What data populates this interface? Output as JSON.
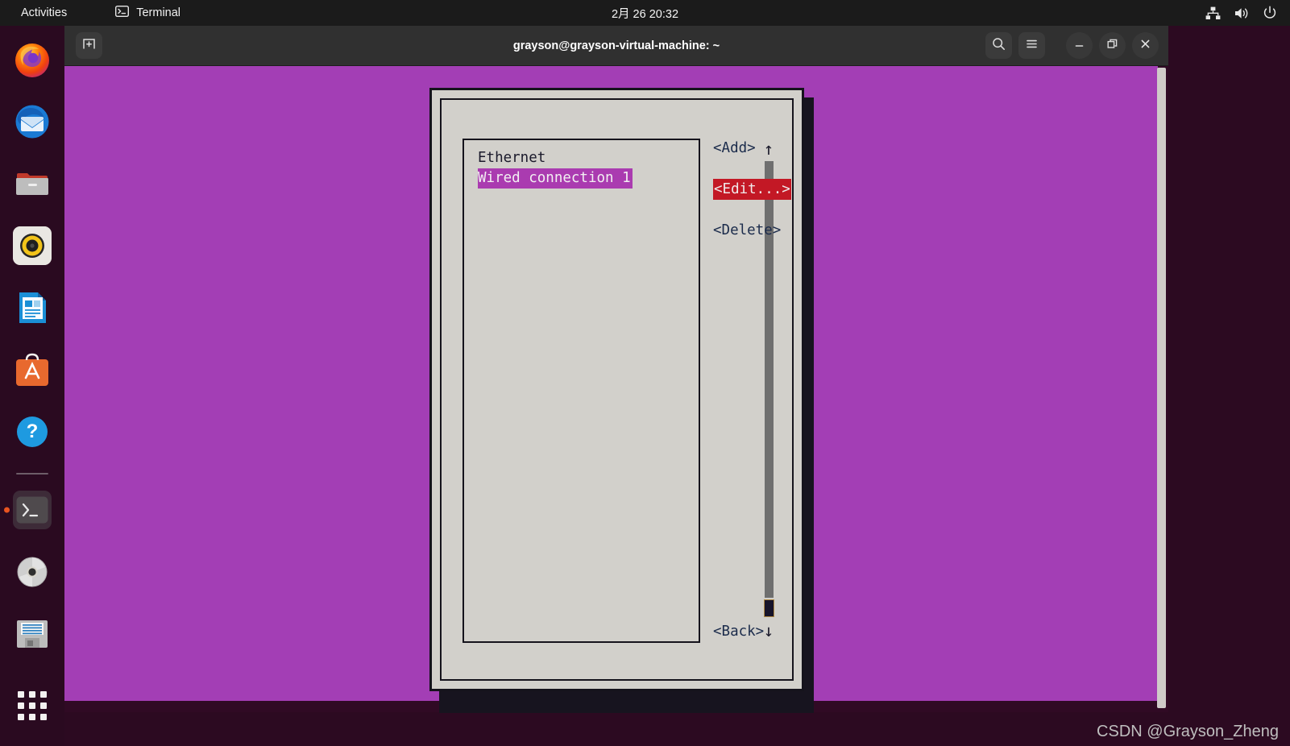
{
  "topbar": {
    "activities": "Activities",
    "app_name": "Terminal",
    "app_icon": "terminal-icon",
    "clock": "2月 26 20:32",
    "indicators": [
      {
        "name": "network-wired-icon",
        "label": "Network"
      },
      {
        "name": "volume-icon",
        "label": "Volume"
      },
      {
        "name": "power-icon",
        "label": "Power"
      }
    ]
  },
  "dock": {
    "items": [
      {
        "name": "firefox",
        "label": "Firefox",
        "running": false
      },
      {
        "name": "thunderbird",
        "label": "Thunderbird",
        "running": false
      },
      {
        "name": "files",
        "label": "Files",
        "running": false
      },
      {
        "name": "rhythmbox",
        "label": "Rhythmbox",
        "running": false
      },
      {
        "name": "libreoffice-writer",
        "label": "LibreOffice Writer",
        "running": false
      },
      {
        "name": "ubuntu-software",
        "label": "Ubuntu Software",
        "running": false
      },
      {
        "name": "help",
        "label": "Help",
        "running": false
      },
      {
        "name": "terminal",
        "label": "Terminal",
        "running": true
      },
      {
        "name": "disk-drive",
        "label": "CD/DVD Drive",
        "running": false
      },
      {
        "name": "floppy-disk",
        "label": "Floppy Disk",
        "running": false
      }
    ],
    "show_apps_label": "Show Applications"
  },
  "terminal": {
    "title": "grayson@grayson-virtual-machine: ~",
    "titlebar_buttons": {
      "new_tab": "new-tab-icon",
      "search": "search-icon",
      "menu": "hamburger-menu-icon",
      "minimize": "minimize-icon",
      "maximize": "maximize-icon",
      "close": "close-icon"
    }
  },
  "nmtui": {
    "list": {
      "group_label": "Ethernet",
      "items": [
        {
          "label": "Wired connection 1",
          "selected": true
        }
      ]
    },
    "scrollbar": {
      "up_arrow": "↑",
      "down_arrow": "↓"
    },
    "buttons": [
      {
        "label": "<Add>",
        "focused": false
      },
      {
        "label": "<Edit...>",
        "focused": true
      },
      {
        "label": "<Delete>",
        "focused": false
      }
    ],
    "back_button": {
      "label": "<Back>",
      "focused": false
    },
    "colors": {
      "dialog_bg": "#d2d0cb",
      "selection": "#aa3bb0",
      "focused_button": "#c31825",
      "border": "#15131c"
    }
  },
  "watermark": "CSDN @Grayson_Zheng"
}
